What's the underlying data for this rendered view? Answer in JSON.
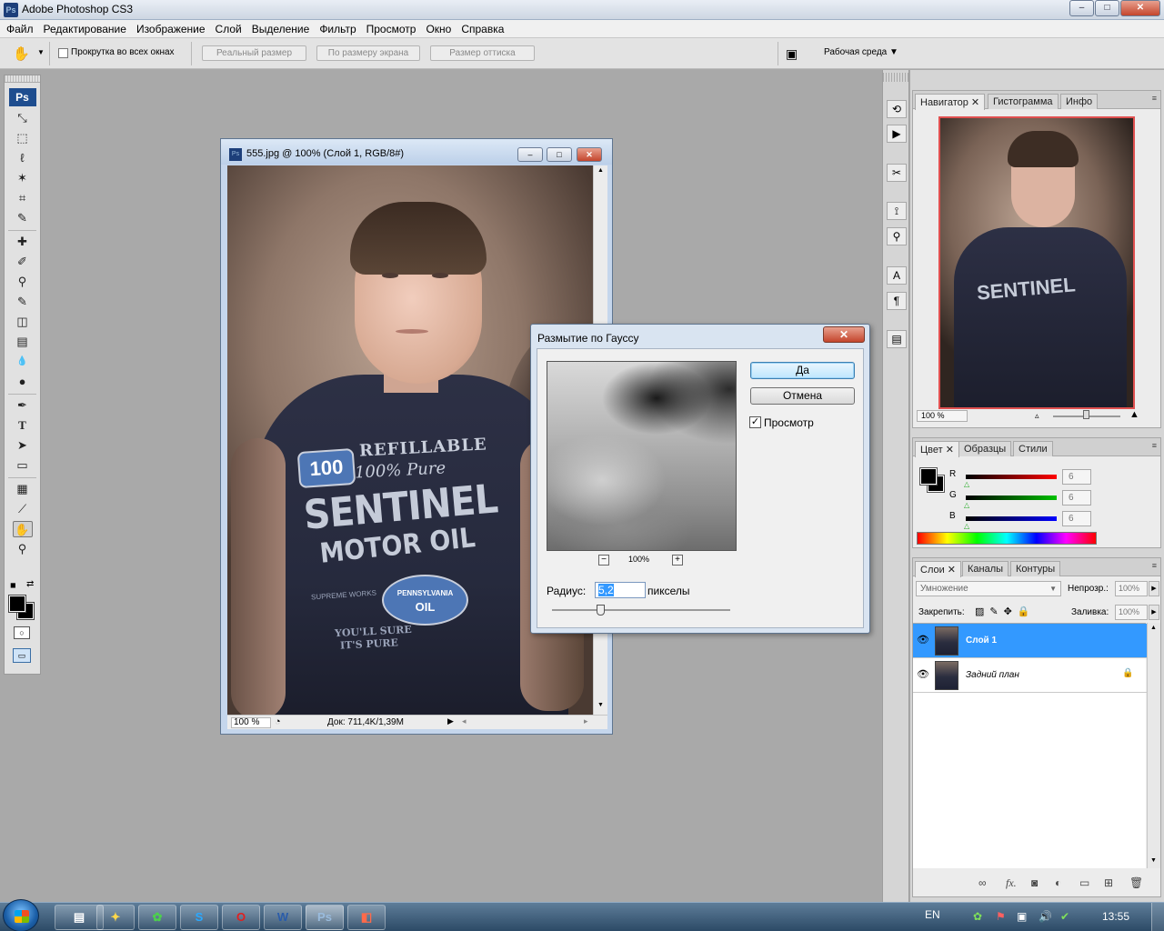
{
  "app": {
    "title": "Adobe Photoshop CS3",
    "logo_text": "Ps",
    "window_buttons": {
      "minimize": "–",
      "maximize": "□",
      "close": "✕"
    }
  },
  "menu": [
    "Файл",
    "Редактирование",
    "Изображение",
    "Слой",
    "Выделение",
    "Фильтр",
    "Просмотр",
    "Окно",
    "Справка"
  ],
  "options": {
    "scroll_all_label": "Прокрутка во всех окнах",
    "actual_pixels": "Реальный размер",
    "fit_screen": "По размеру экрана",
    "print_size": "Размер оттиска",
    "workspace_label": "Рабочая среда ▼"
  },
  "toolbox": {
    "logo_text": "Ps",
    "tools": [
      {
        "name": "move-tool",
        "icon": "⤡"
      },
      {
        "name": "marquee-tool",
        "icon": "⬚"
      },
      {
        "name": "lasso-tool",
        "icon": "ℓ"
      },
      {
        "name": "magic-wand-tool",
        "icon": "✶"
      },
      {
        "name": "crop-tool",
        "icon": "⌗"
      },
      {
        "name": "slice-tool",
        "icon": "✎"
      },
      {
        "name": "healing-brush-tool",
        "icon": "✚"
      },
      {
        "name": "brush-tool",
        "icon": "✐"
      },
      {
        "name": "clone-stamp-tool",
        "icon": "⚲"
      },
      {
        "name": "history-brush-tool",
        "icon": "✎"
      },
      {
        "name": "eraser-tool",
        "icon": "◫"
      },
      {
        "name": "gradient-tool",
        "icon": "▤"
      },
      {
        "name": "blur-tool",
        "icon": "💧"
      },
      {
        "name": "dodge-tool",
        "icon": "●"
      },
      {
        "name": "pen-tool",
        "icon": "✒"
      },
      {
        "name": "type-tool",
        "icon": "T"
      },
      {
        "name": "path-selection-tool",
        "icon": "➤"
      },
      {
        "name": "shape-tool",
        "icon": "▭"
      },
      {
        "name": "notes-tool",
        "icon": "▦"
      },
      {
        "name": "eyedropper-tool",
        "icon": "⟋"
      },
      {
        "name": "hand-tool",
        "icon": "✋"
      },
      {
        "name": "zoom-tool",
        "icon": "⚲"
      }
    ]
  },
  "document": {
    "title": "555.jpg @ 100% (Слой 1, RGB/8#)",
    "icon_text": "Ps",
    "zoom": "100 %",
    "doc_size": "Док: 711,4K/1,39M",
    "shirt_text": {
      "line1": "REFILLABLE",
      "line2": "100% Pure",
      "line3": "SENTINEL",
      "line4": "MOTOR OIL",
      "badge": "100",
      "badge2_line1": "PENNSYLVANIA",
      "badge2_line2": "OIL",
      "small1": "SUPREME WORKS",
      "small2": "YOU'LL SURE",
      "small3": "IT'S PURE"
    }
  },
  "dialog": {
    "title": "Размытие по Гауссу",
    "ok": "Да",
    "cancel": "Отмена",
    "preview_label": "Просмотр",
    "preview_checked": true,
    "zoom": "100%",
    "radius_label": "Радиус:",
    "radius_value": "5,2",
    "radius_unit": "пикселы",
    "radius_slider_fraction": 0.27
  },
  "navigator": {
    "tabs": [
      "Навигатор",
      "Гистограмма",
      "Инфо"
    ],
    "zoom": "100 %",
    "viewbox_color": "#e05050"
  },
  "color_panel": {
    "tabs": [
      "Цвет",
      "Образцы",
      "Стили"
    ],
    "channels": [
      {
        "label": "R",
        "value": "6",
        "color": "#ff0000"
      },
      {
        "label": "G",
        "value": "6",
        "color": "#00c000"
      },
      {
        "label": "B",
        "value": "6",
        "color": "#0000ff"
      }
    ]
  },
  "layers_panel": {
    "tabs": [
      "Слои",
      "Каналы",
      "Контуры"
    ],
    "blend_mode": "Умножение",
    "opacity_label": "Непрозр.:",
    "opacity_value": "100%",
    "lock_label": "Закрепить:",
    "fill_label": "Заливка:",
    "fill_value": "100%",
    "layers": [
      {
        "name": "Слой 1",
        "selected": true,
        "locked": false
      },
      {
        "name": "Задний план",
        "selected": false,
        "locked": true
      }
    ],
    "footer_icons": [
      "link-icon",
      "fx-icon",
      "mask-icon",
      "adjustment-icon",
      "group-icon",
      "new-layer-icon",
      "trash-icon"
    ]
  },
  "taskbar": {
    "items": [
      {
        "name": "explorer",
        "label": "▤"
      },
      {
        "name": "butterfly",
        "label": "✦"
      },
      {
        "name": "clover",
        "label": "✿"
      },
      {
        "name": "skype",
        "label": "S"
      },
      {
        "name": "opera",
        "label": "O"
      },
      {
        "name": "word",
        "label": "W"
      },
      {
        "name": "photoshop",
        "label": "Ps"
      },
      {
        "name": "app",
        "label": "◧"
      }
    ],
    "lang": "EN",
    "time": "13:55"
  }
}
